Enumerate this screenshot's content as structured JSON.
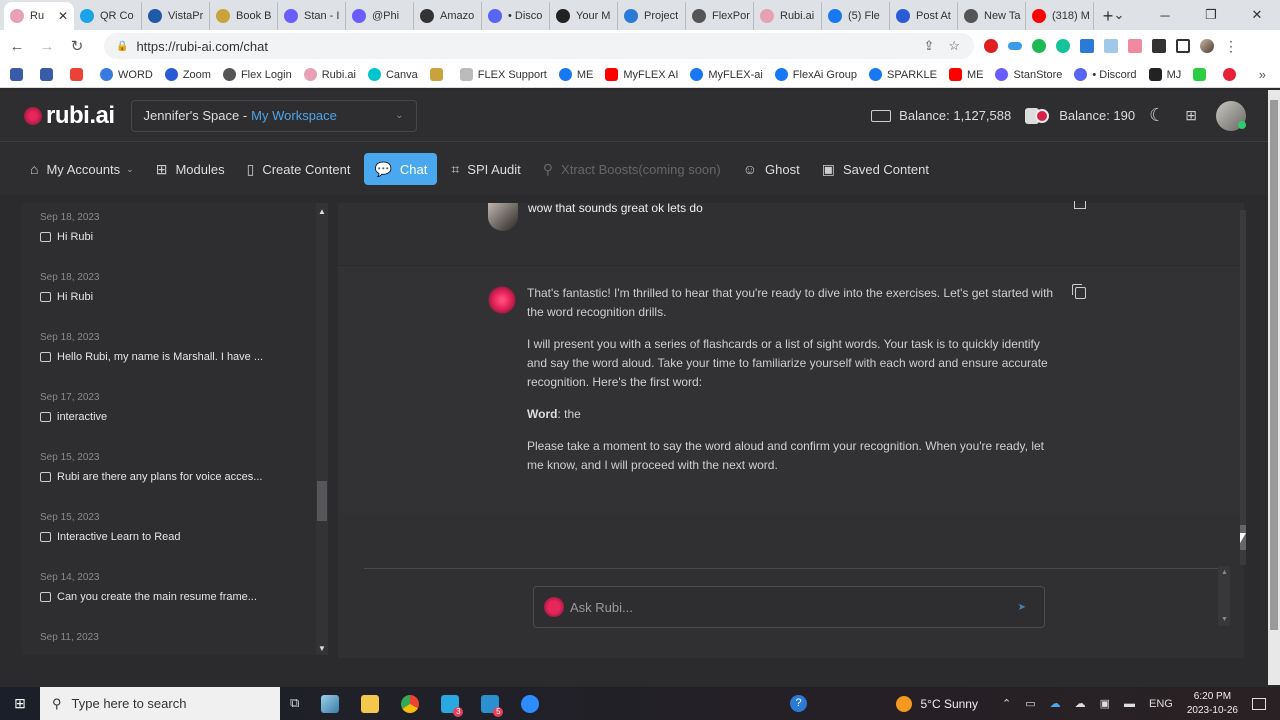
{
  "browser": {
    "tabs": [
      {
        "label": "Ru",
        "color": "#e8a0b4",
        "active": true
      },
      {
        "label": "QR Co",
        "color": "#1aa3e8"
      },
      {
        "label": "VistaPr",
        "color": "#1e5aa8"
      },
      {
        "label": "Book B",
        "color": "#c8a23a"
      },
      {
        "label": "Stan - I",
        "color": "#6a5cff"
      },
      {
        "label": "@Phi",
        "color": "#6a5cff"
      },
      {
        "label": "Amazo",
        "color": "#333333"
      },
      {
        "label": "• Disco",
        "color": "#5865f2"
      },
      {
        "label": "Your M",
        "color": "#222222"
      },
      {
        "label": "Project",
        "color": "#2a7ad6"
      },
      {
        "label": "FlexPor",
        "color": "#555555"
      },
      {
        "label": "Rubi.ai",
        "color": "#e8a0b4"
      },
      {
        "label": "(5) Fle",
        "color": "#1877f2"
      },
      {
        "label": "Post At",
        "color": "#2a5bd7"
      },
      {
        "label": "New Ta",
        "color": "#555555"
      },
      {
        "label": "(318) M",
        "color": "#ff0000"
      }
    ],
    "new_tab_label": "+",
    "url": "https://rubi-ai.com/chat",
    "bookmarks": [
      {
        "label": "",
        "color": "#3a5ba8",
        "icon": "jw-icon"
      },
      {
        "label": "",
        "color": "#3a5ba8",
        "icon": "jw-icon"
      },
      {
        "label": "",
        "color": "#ea4335",
        "icon": "gmail-icon"
      },
      {
        "label": "WORD",
        "color": "#3a7be0",
        "icon": "word-icon"
      },
      {
        "label": "Zoom",
        "color": "#2a5bd7",
        "icon": "zoom-icon"
      },
      {
        "label": "Flex Login",
        "color": "#555555",
        "icon": "globe-icon"
      },
      {
        "label": "Rubi.ai",
        "color": "#e8a0b4",
        "icon": "rubi-icon"
      },
      {
        "label": "Canva",
        "color": "#00c4cc",
        "icon": "canva-icon"
      },
      {
        "label": "",
        "color": "#c8a23a",
        "icon": "bf-icon"
      },
      {
        "label": "FLEX Support",
        "color": "#bbbbbb",
        "icon": "support-icon"
      },
      {
        "label": "ME",
        "color": "#1877f2",
        "icon": "facebook-icon"
      },
      {
        "label": "MyFLEX AI",
        "color": "#ff0000",
        "icon": "youtube-icon"
      },
      {
        "label": "MyFLEX-ai",
        "color": "#1877f2",
        "icon": "facebook-icon"
      },
      {
        "label": "FlexAi Group",
        "color": "#1877f2",
        "icon": "facebook-icon"
      },
      {
        "label": "SPARKLE",
        "color": "#1877f2",
        "icon": "facebook-icon"
      },
      {
        "label": "ME",
        "color": "#ff0000",
        "icon": "youtube-icon"
      },
      {
        "label": "StanStore",
        "color": "#6a5cff",
        "icon": "stan-icon"
      },
      {
        "label": "• Discord",
        "color": "#5865f2",
        "icon": "discord-icon"
      },
      {
        "label": "MJ",
        "color": "#222222",
        "icon": "midjourney-icon"
      },
      {
        "label": "",
        "color": "#2ecc40",
        "icon": "sparkle-icon"
      },
      {
        "label": "",
        "color": "#e8213a",
        "icon": "music-icon"
      }
    ],
    "bookmarks_more": "»"
  },
  "app": {
    "logo": "rubi.ai",
    "workspace": {
      "owner": "Jennifer's Space - ",
      "name": "My Workspace"
    },
    "balance_words": "Balance: 1,127,588",
    "balance_credits": "Balance: 190",
    "nav": [
      {
        "label": "My Accounts",
        "icon": "⌂",
        "name": "home-icon",
        "caret": true
      },
      {
        "label": "Modules",
        "icon": "⊞",
        "name": "modules-icon"
      },
      {
        "label": "Create Content",
        "icon": "▯",
        "name": "document-icon"
      },
      {
        "label": "Chat",
        "icon": "💬",
        "name": "chat-icon",
        "active": true
      },
      {
        "label": "SPI Audit",
        "icon": "⌗",
        "name": "map-icon"
      },
      {
        "label": "Xtract Boosts(coming soon)",
        "icon": "⚲",
        "name": "rocket-icon",
        "disabled": true
      },
      {
        "label": "Ghost",
        "icon": "☺",
        "name": "ghost-icon"
      },
      {
        "label": "Saved Content",
        "icon": "▣",
        "name": "save-icon"
      }
    ]
  },
  "history": [
    {
      "date": "Sep 18, 2023",
      "title": "Hi Rubi"
    },
    {
      "date": "Sep 18, 2023",
      "title": "Hi Rubi"
    },
    {
      "date": "Sep 18, 2023",
      "title": "Hello Rubi, my name is Marshall. I have ..."
    },
    {
      "date": "Sep 17, 2023",
      "title": "interactive"
    },
    {
      "date": "Sep 15, 2023",
      "title": "Rubi are there any plans for voice acces..."
    },
    {
      "date": "Sep 15, 2023",
      "title": "Interactive Learn to Read"
    },
    {
      "date": "Sep 14, 2023",
      "title": "Can you create the main resume frame..."
    },
    {
      "date": "Sep 11, 2023",
      "title": ""
    }
  ],
  "chat": {
    "user_message": "wow that sounds great ok lets do",
    "ai_paragraphs": [
      "That's fantastic! I'm thrilled to hear that you're ready to dive into the exercises. Let's get started with the word recognition drills.",
      "I will present you with a series of flashcards or a list of sight words. Your task is to quickly identify and say the word aloud. Take your time to familiarize yourself with each word and ensure accurate recognition. Here's the first word:"
    ],
    "word_label": "Word",
    "word_value": ": the",
    "ai_closing": "Please take a moment to say the word aloud and confirm your recognition. When you're ready, let me know, and I will proceed with the next word.",
    "input_placeholder": "Ask Rubi..."
  },
  "taskbar": {
    "search_placeholder": "Type here to search",
    "weather": "5°C  Sunny",
    "language": "ENG",
    "time": "6:20 PM",
    "date": "2023-10-26",
    "badges": {
      "app1": "3",
      "app2": "5"
    }
  }
}
